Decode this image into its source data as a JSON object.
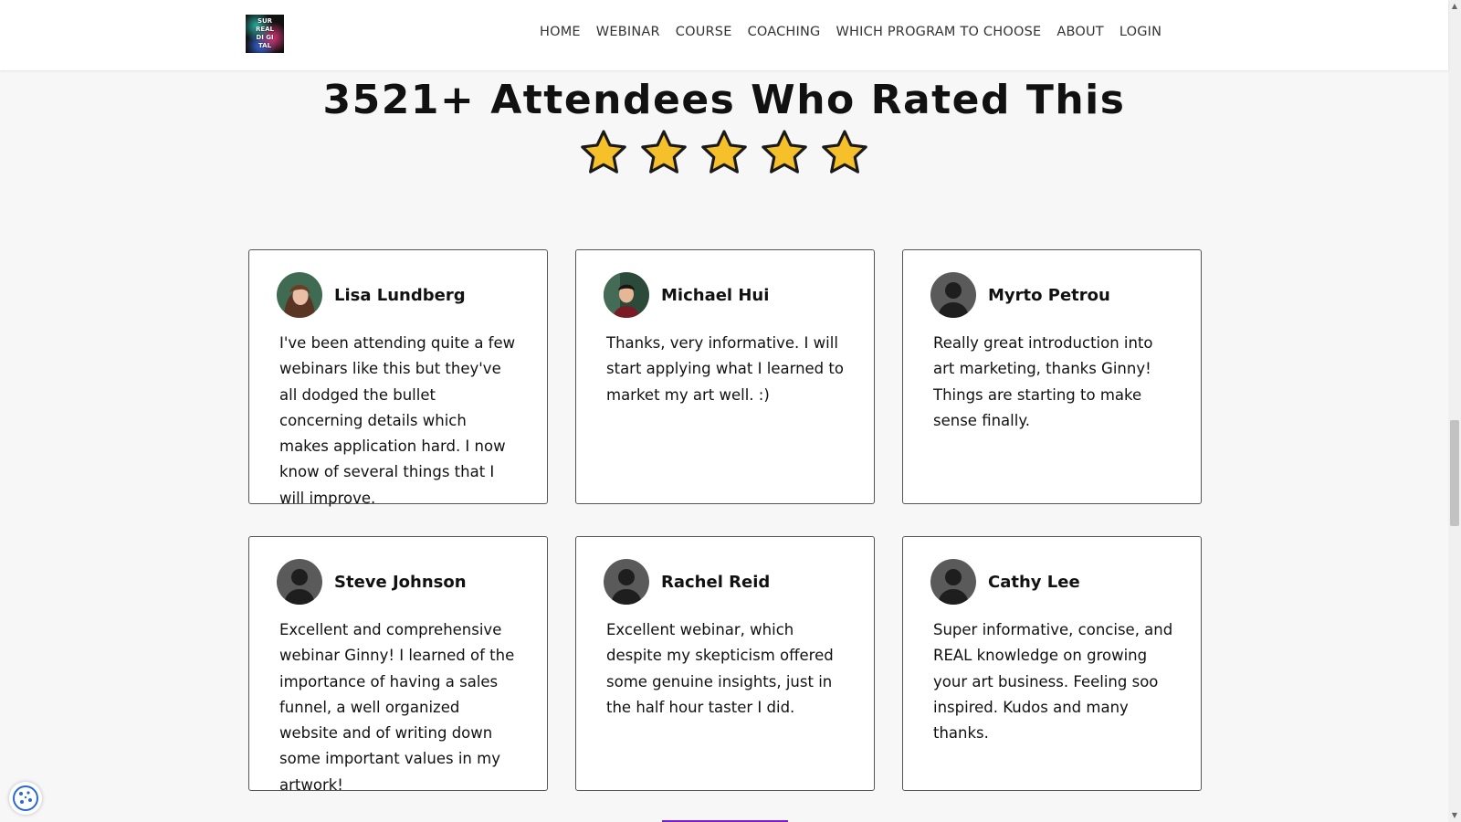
{
  "logo": {
    "lines": [
      "SUR",
      "REAL",
      "DI GI",
      "TAL"
    ]
  },
  "nav": {
    "items": [
      "HOME",
      "WEBINAR",
      "COURSE",
      "COACHING",
      "WHICH PROGRAM TO CHOOSE",
      "ABOUT",
      "LOGIN"
    ]
  },
  "headline": "3521+ Attendees Who Rated This",
  "rating": {
    "stars": 5,
    "max": 5,
    "star_color": "#f5c02a"
  },
  "testimonials": [
    {
      "name": "Lisa Lundberg",
      "avatar": "photo",
      "quote": "I've been attending quite a few webinars like this but they've all dodged the bullet concerning details which makes application hard. I now know of several things that I will improve."
    },
    {
      "name": "Michael Hui",
      "avatar": "photo",
      "quote": "Thanks, very informative. I will start applying what I learned to market my art well. :)"
    },
    {
      "name": "Myrto Petrou",
      "avatar": "silhouette",
      "quote": "Really great introduction into art marketing, thanks Ginny! Things are starting to make sense finally."
    },
    {
      "name": "Steve Johnson",
      "avatar": "silhouette",
      "quote": "Excellent and comprehensive webinar Ginny! I learned of the importance of having a sales funnel, a well organized website and of writing down some important values in my artwork!"
    },
    {
      "name": "Rachel Reid",
      "avatar": "silhouette",
      "quote": "Excellent webinar, which despite my skepticism offered some genuine insights, just in the half hour taster I did."
    },
    {
      "name": "Cathy Lee",
      "avatar": "silhouette",
      "quote": "Super informative, concise, and REAL knowledge on growing your art business. Feeling soo inspired. Kudos and many thanks."
    }
  ],
  "colors": {
    "accent": "#7a1fd0",
    "card_border": "#555555",
    "background": "#f7f7f7"
  },
  "icons": {
    "cookie": "cookie-icon",
    "star": "star-icon"
  }
}
